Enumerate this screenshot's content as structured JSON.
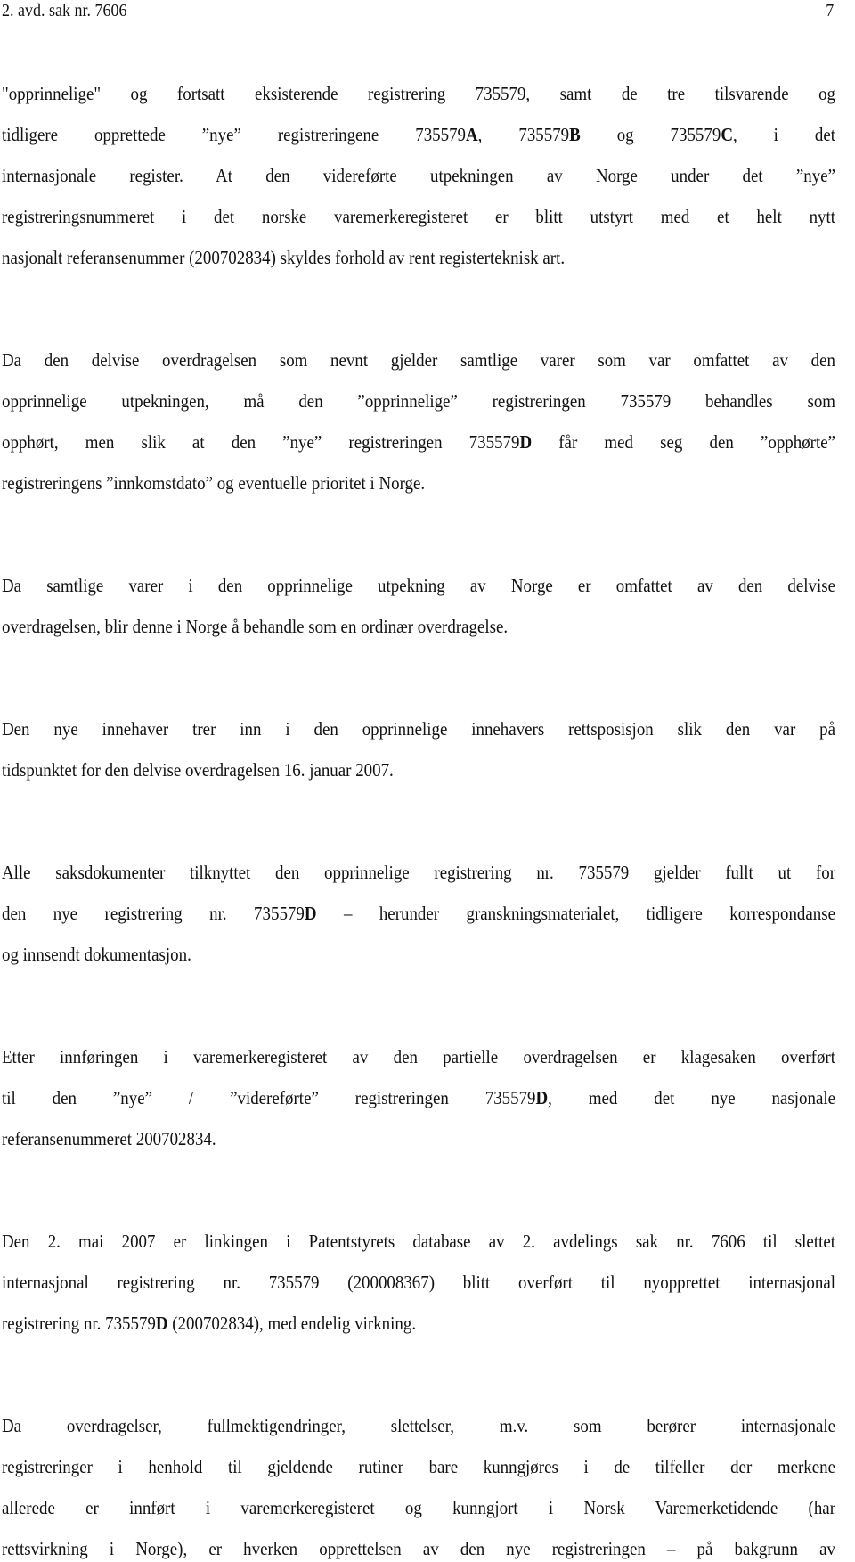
{
  "header": {
    "left": "2. avd. sak nr. 7606",
    "page_number": "7"
  },
  "paragraphs": [
    {
      "lines": [
        {
          "justify": true,
          "segments": [
            {
              "t": "\"opprinnelige\" og fortsatt eksisterende registrering 735579, samt de tre tilsvarende og"
            }
          ]
        },
        {
          "justify": true,
          "segments": [
            {
              "t": "tidligere opprettede ”nye” registreringene 735579"
            },
            {
              "t": "A",
              "b": true
            },
            {
              "t": ", 735579"
            },
            {
              "t": "B",
              "b": true
            },
            {
              "t": " og 735579"
            },
            {
              "t": "C",
              "b": true
            },
            {
              "t": ", i det"
            }
          ]
        },
        {
          "justify": true,
          "segments": [
            {
              "t": "internasjonale register. At den videreførte utpekningen av Norge under det ”nye”"
            }
          ]
        },
        {
          "justify": true,
          "segments": [
            {
              "t": "registreringsnummeret i det norske varemerkeregisteret er blitt utstyrt med et helt nytt"
            }
          ]
        },
        {
          "justify": false,
          "segments": [
            {
              "t": "nasjonalt referansenummer (200702834) skyldes forhold av rent registerteknisk art."
            }
          ]
        }
      ]
    },
    {
      "lines": [
        {
          "justify": true,
          "segments": [
            {
              "t": "Da den delvise overdragelsen som nevnt gjelder samtlige varer som var omfattet av den"
            }
          ]
        },
        {
          "justify": true,
          "segments": [
            {
              "t": "opprinnelige utpekningen, må den ”opprinnelige” registreringen 735579 behandles som"
            }
          ]
        },
        {
          "justify": true,
          "segments": [
            {
              "t": "opphørt, men slik at den ”nye” registreringen 735579"
            },
            {
              "t": "D",
              "b": true
            },
            {
              "t": " får med seg den ”opphørte”"
            }
          ]
        },
        {
          "justify": false,
          "segments": [
            {
              "t": "registreringens ”innkomstdato” og eventuelle prioritet i Norge."
            }
          ]
        }
      ]
    },
    {
      "lines": [
        {
          "justify": true,
          "segments": [
            {
              "t": "Da samtlige varer i den opprinnelige utpekning av Norge er omfattet av den delvise"
            }
          ]
        },
        {
          "justify": false,
          "segments": [
            {
              "t": "overdragelsen, blir denne i Norge å behandle som en ordinær overdragelse."
            }
          ]
        }
      ]
    },
    {
      "lines": [
        {
          "justify": true,
          "segments": [
            {
              "t": "Den nye innehaver trer inn i den opprinnelige innehavers rettsposisjon slik den var på"
            }
          ]
        },
        {
          "justify": false,
          "segments": [
            {
              "t": "tidspunktet for den delvise overdragelsen 16. januar 2007."
            }
          ]
        }
      ]
    },
    {
      "lines": [
        {
          "justify": true,
          "segments": [
            {
              "t": "Alle saksdokumenter tilknyttet den opprinnelige registrering nr. 735579 gjelder fullt ut for"
            }
          ]
        },
        {
          "justify": true,
          "segments": [
            {
              "t": "den nye registrering nr. 735579"
            },
            {
              "t": "D",
              "b": true
            },
            {
              "t": " – herunder granskningsmaterialet, tidligere korrespondanse"
            }
          ]
        },
        {
          "justify": false,
          "segments": [
            {
              "t": "og innsendt dokumentasjon."
            }
          ]
        }
      ]
    },
    {
      "lines": [
        {
          "justify": true,
          "segments": [
            {
              "t": "Etter innføringen i varemerkeregisteret av den partielle overdragelsen er klagesaken overført"
            }
          ]
        },
        {
          "justify": true,
          "segments": [
            {
              "t": "til den ”nye” / ”videreførte” registreringen 735579"
            },
            {
              "t": "D",
              "b": true
            },
            {
              "t": ", med det nye nasjonale"
            }
          ]
        },
        {
          "justify": false,
          "segments": [
            {
              "t": "referansenummeret 200702834."
            }
          ]
        }
      ]
    },
    {
      "lines": [
        {
          "justify": true,
          "segments": [
            {
              "t": "Den 2. mai 2007 er linkingen i Patentstyrets database av 2. avdelings sak nr. 7606 til slettet"
            }
          ]
        },
        {
          "justify": true,
          "segments": [
            {
              "t": "internasjonal registrering nr. 735579 (200008367) blitt overført til nyopprettet internasjonal"
            }
          ]
        },
        {
          "justify": false,
          "segments": [
            {
              "t": "registrering nr. 735579"
            },
            {
              "t": "D",
              "b": true
            },
            {
              "t": " (200702834), med endelig virkning."
            }
          ]
        }
      ]
    },
    {
      "lines": [
        {
          "justify": true,
          "segments": [
            {
              "t": "Da overdragelser, fullmektigendringer, slettelser, m.v. som berører internasjonale"
            }
          ]
        },
        {
          "justify": true,
          "segments": [
            {
              "t": "registreringer i henhold til gjeldende rutiner bare kunngjøres i de tilfeller der merkene"
            }
          ]
        },
        {
          "justify": true,
          "segments": [
            {
              "t": "allerede er innført i varemerkeregisteret og kunngjort i Norsk Varemerketidende (har"
            }
          ]
        },
        {
          "justify": true,
          "segments": [
            {
              "t": "rettsvirkning i Norge), er hverken opprettelsen av den nye registreringen – på bakgrunn av"
            }
          ]
        }
      ]
    }
  ]
}
